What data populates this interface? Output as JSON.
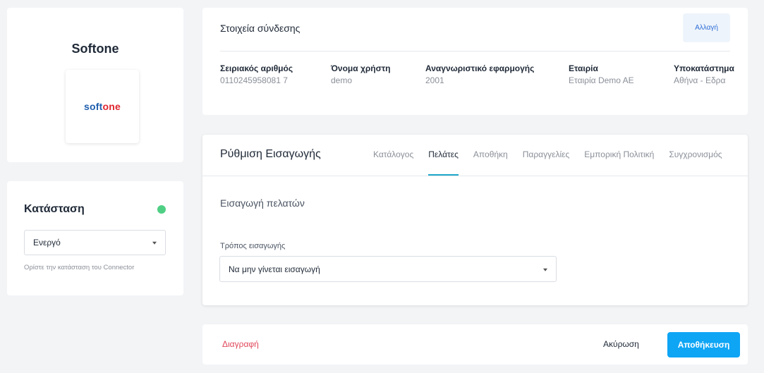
{
  "brand": {
    "name": "Softone",
    "logo_text_part1": "soft",
    "logo_text_part2": "one"
  },
  "status": {
    "title": "Κατάσταση",
    "indicator_color": "#4fcf84",
    "selected": "Ενεργό",
    "help": "Ορίστε την κατάσταση του Connector"
  },
  "connection": {
    "title": "Στοιχεία σύνδεσης",
    "change_label": "Αλλαγή",
    "fields": [
      {
        "label": "Σειριακός αριθμός",
        "value": "0110245958081 7"
      },
      {
        "label": "Όνομα χρήστη",
        "value": "demo"
      },
      {
        "label": "Αναγνωριστικό εφαρμογής",
        "value": "2001"
      },
      {
        "label": "Εταιρία",
        "value": "Εταιρία Demo AE"
      },
      {
        "label": "Υποκατάστημα",
        "value": "Αθήνα - Εδρα"
      }
    ]
  },
  "import_settings": {
    "title": "Ρύθμιση Εισαγωγής",
    "tabs": [
      {
        "label": "Κατάλογος",
        "active": false
      },
      {
        "label": "Πελάτες",
        "active": true
      },
      {
        "label": "Αποθήκη",
        "active": false
      },
      {
        "label": "Παραγγελίες",
        "active": false
      },
      {
        "label": "Εμπορική Πολιτική",
        "active": false
      },
      {
        "label": "Συγχρονισμός",
        "active": false
      }
    ],
    "section_title": "Εισαγωγή πελατών",
    "mode_label": "Τρόπος εισαγωγής",
    "mode_selected": "Να μην γίνεται εισαγωγή"
  },
  "actions": {
    "delete_label": "Διαγραφή",
    "cancel_label": "Ακύρωση",
    "save_label": "Αποθήκευση"
  },
  "colors": {
    "accent": "#0ea5f5",
    "tab_underline": "#1fa8c9",
    "danger": "#e0485b",
    "logo_blue": "#1f5fae",
    "logo_red": "#e0262f"
  }
}
